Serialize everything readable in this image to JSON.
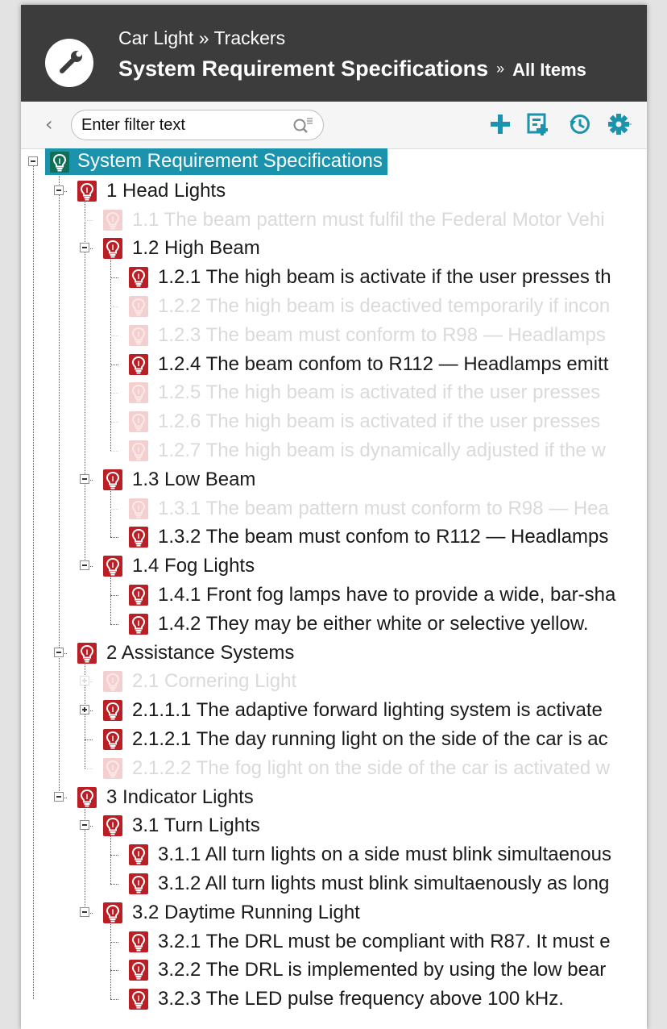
{
  "header": {
    "breadcrumb": "Car Light » Trackers",
    "title": "System Requirement Specifications",
    "separator": "»",
    "view": "All Items",
    "bg_color": "#3c3c3c"
  },
  "toolbar": {
    "back_icon": "chevron-left-icon",
    "filter_placeholder": "Enter filter text",
    "filter_value": "",
    "actions": [
      "add-icon",
      "add-child-icon",
      "history-icon",
      "settings-icon"
    ]
  },
  "colors": {
    "requirement_icon": "#b91f24",
    "requirement_icon_faded": "#f4cfd0",
    "root_highlight": "#1b93ac",
    "root_icon": "#116f58",
    "text": "#1a1a1a",
    "text_faded": "#dadada"
  },
  "tree": [
    {
      "label": "System Requirement Specifications",
      "level": 0,
      "expander": "minus",
      "faded": false,
      "root": true
    },
    {
      "label": "1 Head Lights",
      "level": 1,
      "expander": "minus",
      "faded": false
    },
    {
      "label": "1.1 The beam pattern must fulfil the Federal Motor Vehi",
      "level": 2,
      "expander": "none",
      "faded": true
    },
    {
      "label": "1.2 High Beam",
      "level": 2,
      "expander": "minus",
      "faded": false
    },
    {
      "label": "1.2.1 The high beam is activate if the user presses th",
      "level": 3,
      "expander": "none",
      "faded": false
    },
    {
      "label": "1.2.2 The high beam is deactived temporarily if incon",
      "level": 3,
      "expander": "none",
      "faded": true
    },
    {
      "label": "1.2.3 The beam must conform to R98 — Headlamps",
      "level": 3,
      "expander": "none",
      "faded": true
    },
    {
      "label": "1.2.4 The beam confom to R112 — Headlamps emitt",
      "level": 3,
      "expander": "none",
      "faded": false
    },
    {
      "label": "1.2.5 The high beam is activated if the user presses",
      "level": 3,
      "expander": "none",
      "faded": true
    },
    {
      "label": "1.2.6 The high beam is activated if the user presses",
      "level": 3,
      "expander": "none",
      "faded": true
    },
    {
      "label": "1.2.7 The high beam is dynamically adjusted if the w",
      "level": 3,
      "expander": "none",
      "faded": true
    },
    {
      "label": "1.3 Low Beam",
      "level": 2,
      "expander": "minus",
      "faded": false
    },
    {
      "label": "1.3.1 The beam pattern must conform to R98 — Hea",
      "level": 3,
      "expander": "none",
      "faded": true
    },
    {
      "label": "1.3.2 The beam must confom to R112 — Headlamps",
      "level": 3,
      "expander": "none",
      "faded": false
    },
    {
      "label": "1.4 Fog Lights",
      "level": 2,
      "expander": "minus",
      "faded": false
    },
    {
      "label": "1.4.1 Front fog lamps have to provide a wide, bar-sha",
      "level": 3,
      "expander": "none",
      "faded": false
    },
    {
      "label": "1.4.2 They may be either white or selective yellow.",
      "level": 3,
      "expander": "none",
      "faded": false
    },
    {
      "label": "2 Assistance Systems",
      "level": 1,
      "expander": "minus",
      "faded": false
    },
    {
      "label": "2.1 Cornering Light",
      "level": 2,
      "expander": "plus",
      "faded": true
    },
    {
      "label": "2.1.1.1 The adaptive forward lighting system is activate",
      "level": 2,
      "expander": "plus",
      "faded": false
    },
    {
      "label": "2.1.2.1 The day running light on the side of the car is ac",
      "level": 2,
      "expander": "none",
      "faded": false
    },
    {
      "label": "2.1.2.2 The fog light on the side of the car is activated w",
      "level": 2,
      "expander": "none",
      "faded": true
    },
    {
      "label": "3 Indicator Lights",
      "level": 1,
      "expander": "minus",
      "faded": false
    },
    {
      "label": "3.1 Turn Lights",
      "level": 2,
      "expander": "minus",
      "faded": false
    },
    {
      "label": "3.1.1 All turn lights on a side must blink simultaenous",
      "level": 3,
      "expander": "none",
      "faded": false
    },
    {
      "label": "3.1.2 All turn lights must blink simultaenously as long",
      "level": 3,
      "expander": "none",
      "faded": false
    },
    {
      "label": "3.2 Daytime Running Light",
      "level": 2,
      "expander": "minus",
      "faded": false
    },
    {
      "label": "3.2.1 The DRL must be compliant with R87. It must e",
      "level": 3,
      "expander": "none",
      "faded": false
    },
    {
      "label": "3.2.2 The DRL is implemented by using the low bear",
      "level": 3,
      "expander": "none",
      "faded": false
    },
    {
      "label": "3.2.3 The LED pulse frequency above 100 kHz.",
      "level": 3,
      "expander": "none",
      "faded": false
    }
  ]
}
